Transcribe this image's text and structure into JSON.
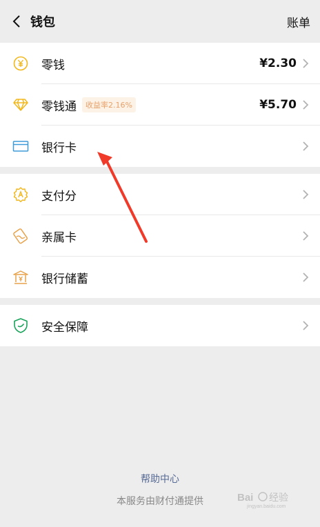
{
  "header": {
    "title": "钱包",
    "bill_label": "账单"
  },
  "group1": [
    {
      "label": "零钱",
      "amount": "¥2.30",
      "icon": "yuan-coin-icon",
      "color": "#f2b71b"
    },
    {
      "label": "零钱通",
      "badge": "收益率2.16%",
      "amount": "¥5.70",
      "icon": "diamond-icon",
      "color": "#f2b71b"
    },
    {
      "label": "银行卡",
      "icon": "bank-card-icon",
      "color": "#3d9bd9"
    }
  ],
  "group2": [
    {
      "label": "支付分",
      "icon": "pay-score-icon",
      "color": "#f2b71b"
    },
    {
      "label": "亲属卡",
      "icon": "family-card-icon",
      "color": "#e8a24a"
    },
    {
      "label": "银行储蓄",
      "icon": "bank-savings-icon",
      "color": "#e8a24a"
    }
  ],
  "group3": [
    {
      "label": "安全保障",
      "icon": "shield-icon",
      "color": "#19a35a"
    }
  ],
  "footer": {
    "help": "帮助中心",
    "provider": "本服务由财付通提供"
  },
  "watermark": {
    "text": "Bai 经验",
    "sub": "jingyan.baidu.com"
  },
  "accent": {
    "arrow": "#f03a2a"
  }
}
